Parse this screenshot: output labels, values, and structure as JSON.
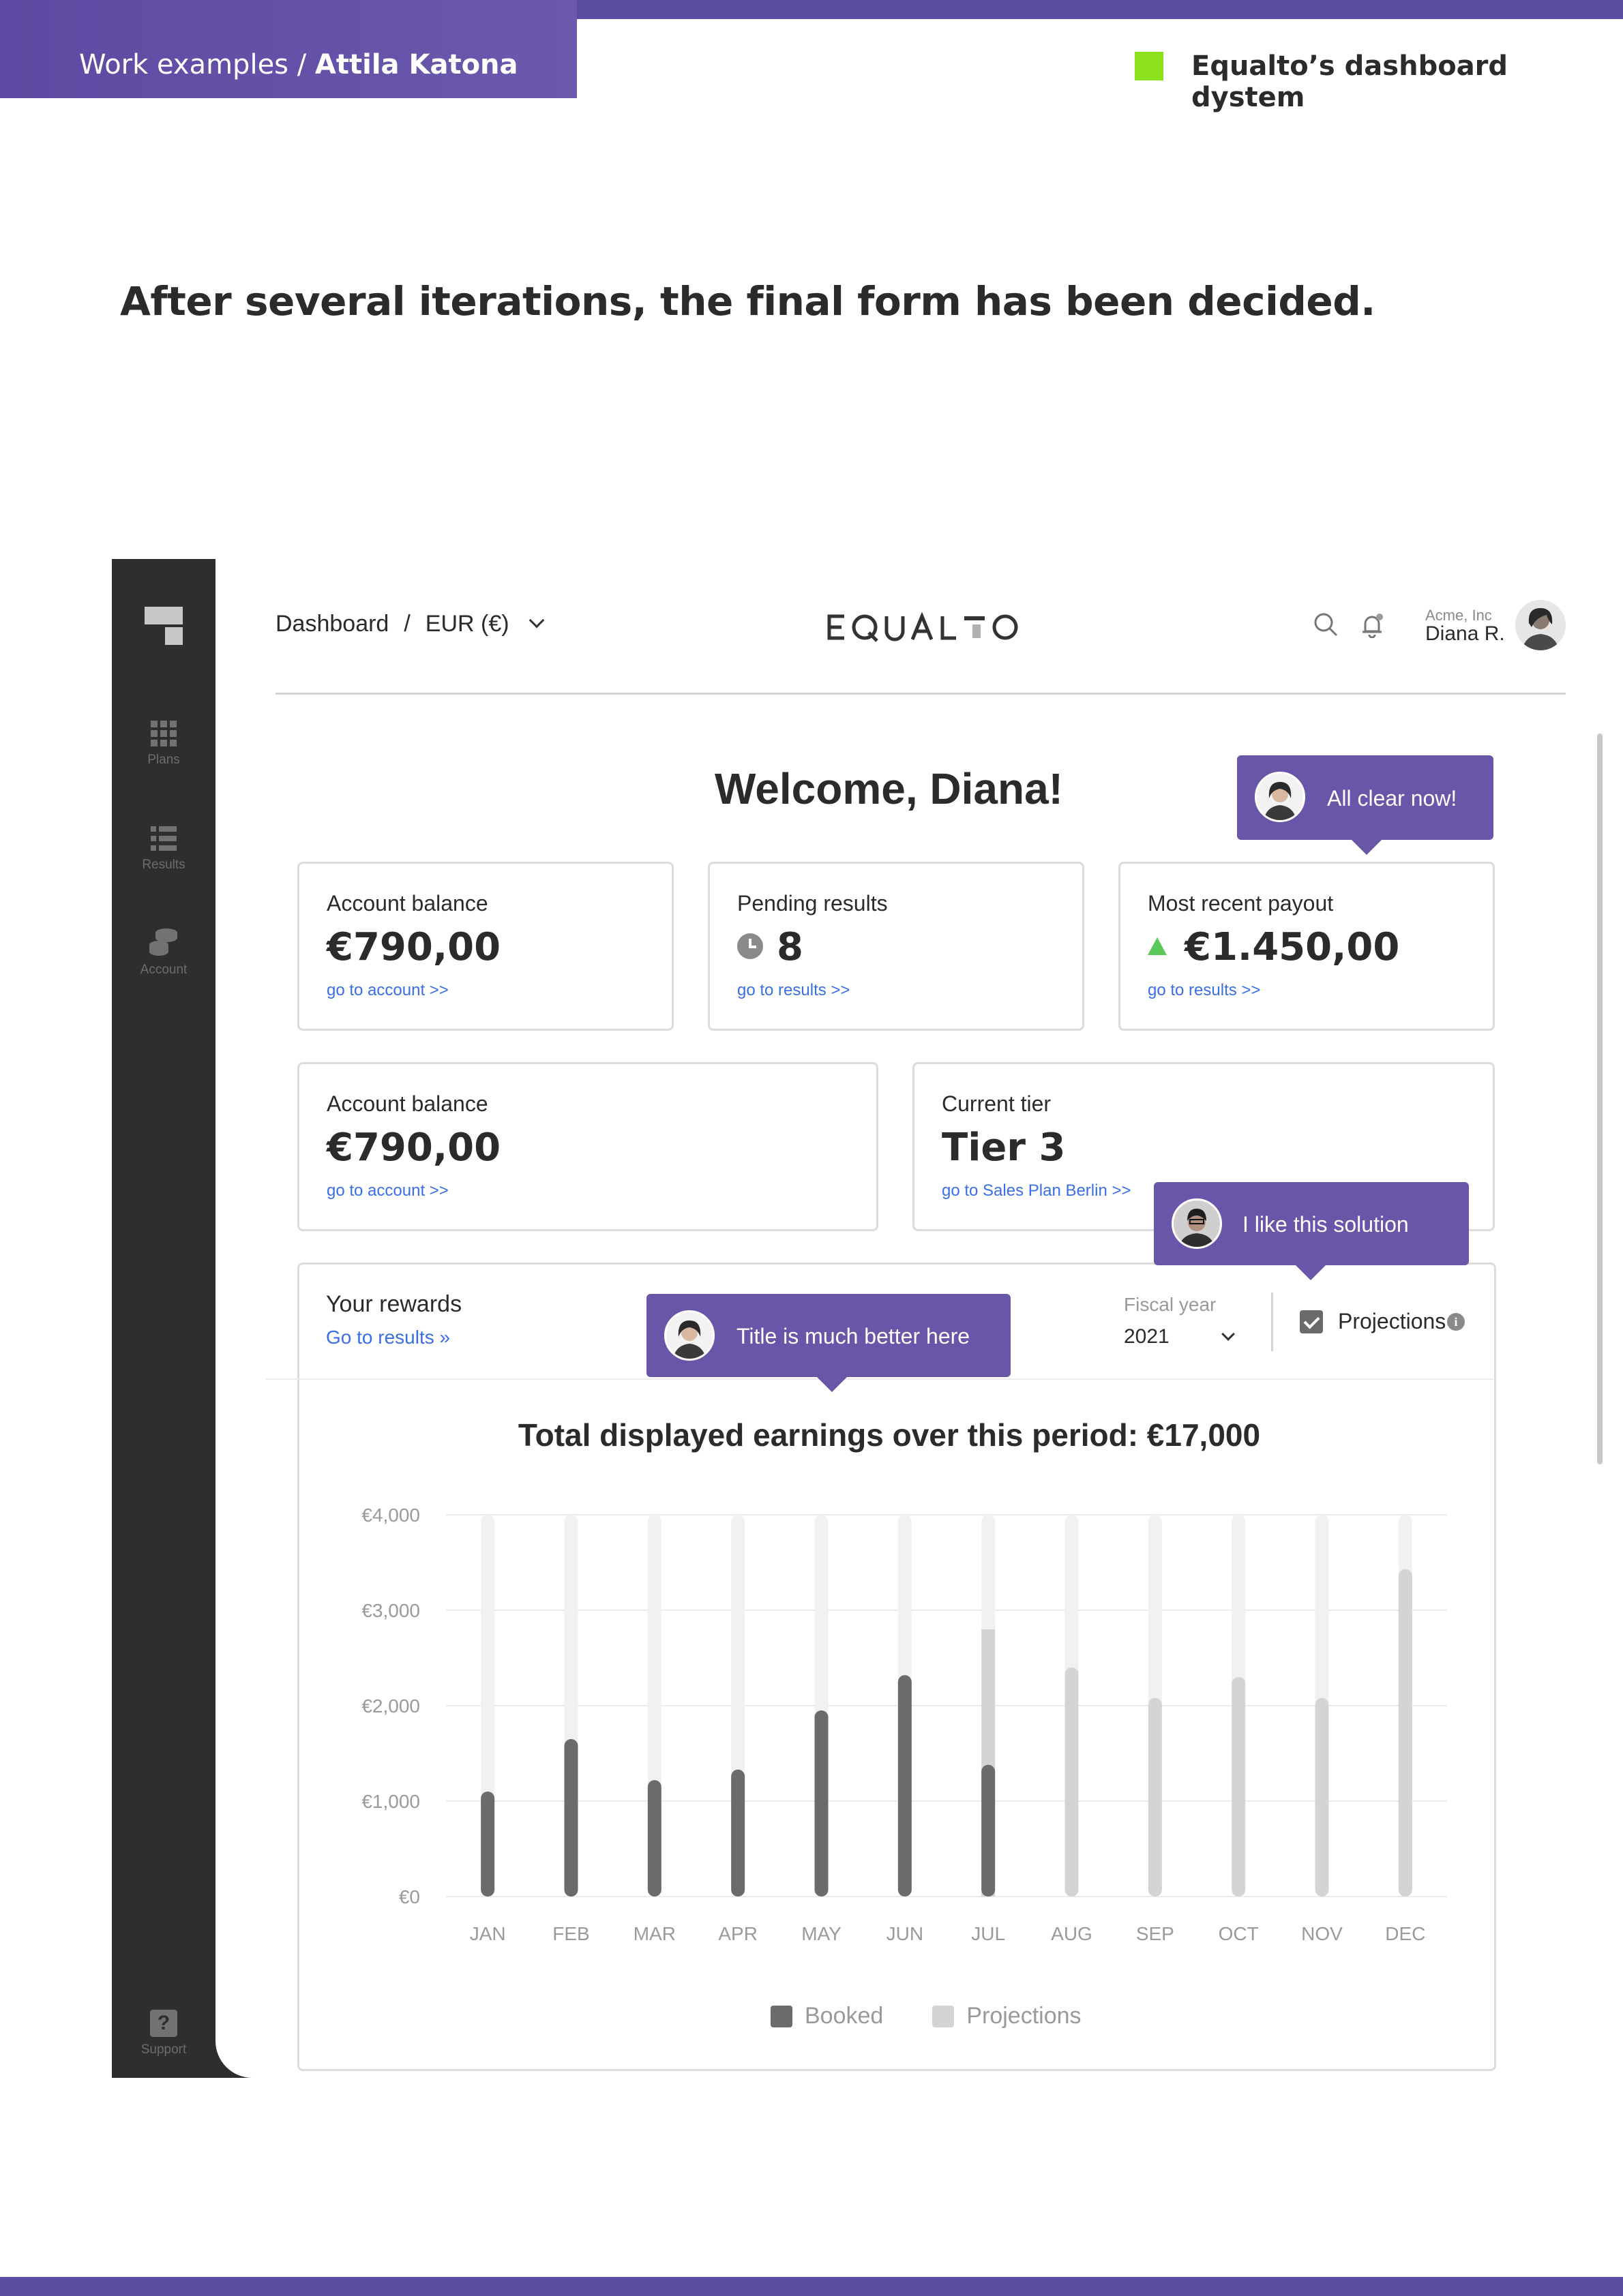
{
  "page_header": {
    "section": "Work examples / ",
    "author": "Attila Katona",
    "project_title": "Equalto’s dashboard dystem",
    "headline": "After several iterations, the final form has been decided."
  },
  "sidebar": {
    "items": [
      {
        "label": "Plans",
        "icon": "grid-icon"
      },
      {
        "label": "Results",
        "icon": "list-icon"
      },
      {
        "label": "Account",
        "icon": "coins-icon"
      }
    ],
    "support_label": "Support"
  },
  "header": {
    "breadcrumb": "Dashboard",
    "separator": "/",
    "currency": "EUR (€)",
    "logo": "EQUALTO",
    "company": "Acme, Inc",
    "user": "Diana R."
  },
  "welcome": "Welcome, Diana!",
  "cards": [
    {
      "label": "Account balance",
      "value": "€790,00",
      "link": "go to account >>"
    },
    {
      "label": "Pending results",
      "value": "8",
      "link": "go to results >>"
    },
    {
      "label": "Most recent payout",
      "value": "€1.450,00",
      "link": "go to results >>"
    },
    {
      "label": "Account balance",
      "value": "€790,00",
      "link": "go to account >>"
    },
    {
      "label": "Current tier",
      "value": "Tier 3",
      "link": "go to Sales Plan Berlin >>"
    }
  ],
  "tooltips": {
    "all_clear": "All clear now!",
    "like_solution": "I like this solution",
    "title_better": "Title is much better here"
  },
  "rewards": {
    "title": "Your rewards",
    "link": "Go to results »",
    "fiscal_label": "Fiscal year",
    "fiscal_value": "2021",
    "projections_label": "Projections",
    "projections_checked": true
  },
  "chart_data": {
    "type": "bar",
    "title": "Total displayed earnings over this period: €17,000",
    "categories": [
      "JAN",
      "FEB",
      "MAR",
      "APR",
      "MAY",
      "JUN",
      "JUL",
      "AUG",
      "SEP",
      "OCT",
      "NOV",
      "DEC"
    ],
    "series": [
      {
        "name": "Booked",
        "values": [
          1100,
          1650,
          1220,
          1330,
          1950,
          2320,
          1380,
          0,
          0,
          0,
          0,
          0
        ]
      },
      {
        "name": "Projections",
        "values": [
          0,
          0,
          0,
          0,
          0,
          0,
          2800,
          2400,
          2080,
          2300,
          2080,
          3430
        ]
      }
    ],
    "y_ticks": [
      "€0",
      "€1,000",
      "€2,000",
      "€3,000",
      "€4,000"
    ],
    "ylim": [
      0,
      4000
    ],
    "grid": true,
    "legend_position": "bottom-center",
    "colors": {
      "booked": "#6b6b6b",
      "projections": "#d4d4d4",
      "track": "#f1f1f1"
    }
  }
}
